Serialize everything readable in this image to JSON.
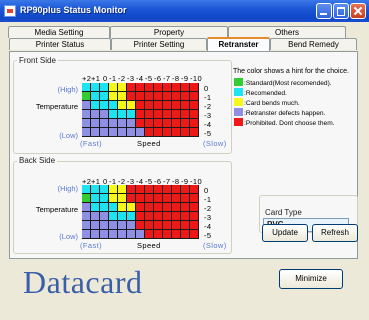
{
  "window": {
    "title": "RP90plus Status Monitor"
  },
  "tabs_top": [
    "Media Setting",
    "Property",
    "Others"
  ],
  "tabs_bottom": [
    "Printer Status",
    "Printer Setting",
    "Retranster",
    "Bend Remedy"
  ],
  "front_side": {
    "label": "Front Side"
  },
  "back_side": {
    "label": "Back Side"
  },
  "axes": {
    "speed_values": [
      "+2",
      "+1",
      "0",
      "-1",
      "-2",
      "-3",
      "-4",
      "-5",
      "-6",
      "-7",
      "-8",
      "-9",
      "-10"
    ],
    "temp_values": [
      "0",
      "-1",
      "-2",
      "-3",
      "-4",
      "-5"
    ],
    "high": "(High)",
    "low": "(Low)",
    "temperature": "Temperature",
    "fast": "(Fast)",
    "speed": "Speed",
    "slow": "(Slow)"
  },
  "grid_matrix": [
    [
      3,
      3,
      3,
      2,
      2,
      1,
      1,
      1,
      1,
      1,
      1,
      1,
      1
    ],
    [
      4,
      3,
      3,
      2,
      2,
      1,
      1,
      1,
      1,
      1,
      1,
      1,
      1
    ],
    [
      0,
      3,
      3,
      3,
      2,
      2,
      1,
      1,
      1,
      1,
      1,
      1,
      1
    ],
    [
      0,
      0,
      0,
      3,
      3,
      3,
      1,
      1,
      1,
      1,
      1,
      1,
      1
    ],
    [
      0,
      0,
      0,
      0,
      0,
      0,
      1,
      1,
      1,
      1,
      1,
      1,
      1
    ],
    [
      0,
      0,
      0,
      0,
      0,
      0,
      0,
      1,
      1,
      1,
      1,
      1,
      1
    ]
  ],
  "grid_colors": [
    "#8f8fe3",
    "#ef1818",
    "#f7f71b",
    "#1ee4f2",
    "#33cc33"
  ],
  "marker_symbol": "*",
  "legend": {
    "head": "The color shows a hint for the choice.",
    "items": [
      {
        "color": "#33cc33",
        "label": ":Standard(Most recomended)."
      },
      {
        "color": "#1ee4f2",
        "label": ":Recomended."
      },
      {
        "color": "#f7f71b",
        "label": ":Card bends much."
      },
      {
        "color": "#8f8fe3",
        "label": ":Retranster defects happen."
      },
      {
        "color": "#ef1818",
        "label": ":Prohibited. Dont choose them."
      }
    ]
  },
  "card_type": {
    "label": "Card Type",
    "value": "PVC"
  },
  "buttons": {
    "update": "Update",
    "refresh": "Refresh",
    "minimize": "Minimize"
  },
  "brand": {
    "logo": "Datacard"
  }
}
